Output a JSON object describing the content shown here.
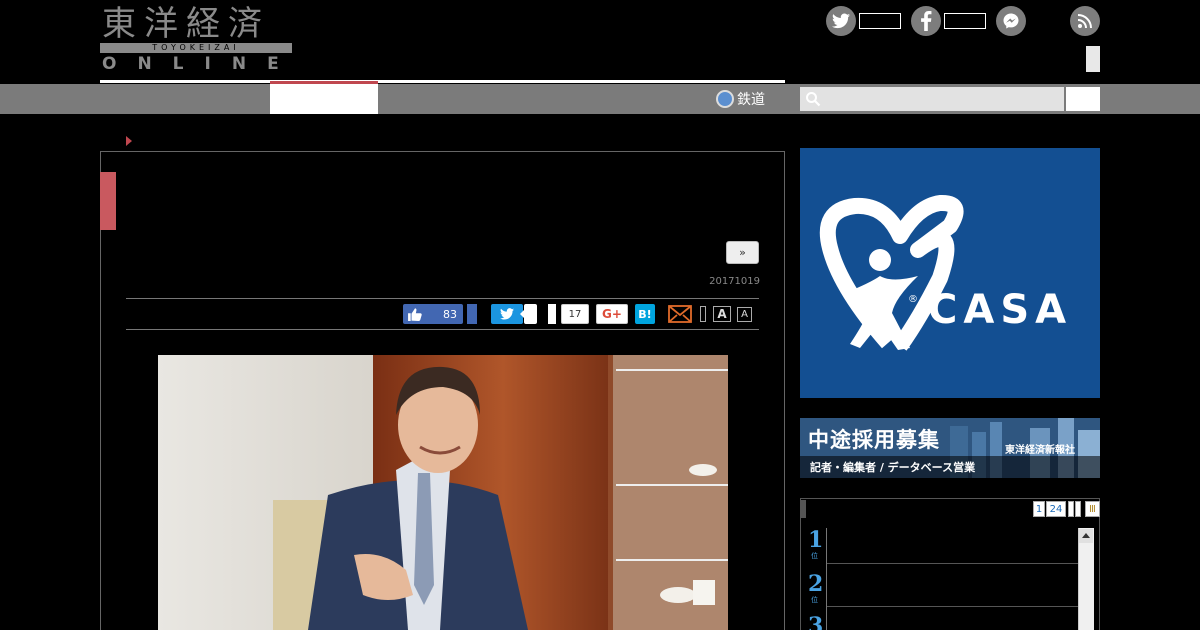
{
  "logo": {
    "kanji": "東洋経済",
    "romaji": "TOYOKEIZAI",
    "online": "ONLINE"
  },
  "header": {
    "social_icons": [
      "twitter-icon",
      "facebook-icon",
      "messenger-icon",
      "rss-icon"
    ]
  },
  "nav": {
    "rail_label": "鉄道"
  },
  "search": {
    "placeholder": ""
  },
  "article": {
    "next_label": "»",
    "date": "20171019",
    "share": {
      "fb_count": "83",
      "gplus_count": "17",
      "gplus_label": "G+",
      "hatena_label": "B!",
      "font_large": "A",
      "font_small": "A"
    }
  },
  "sidebar": {
    "casa_ad": {
      "brand": "CASA",
      "registered": "®"
    },
    "recruit_ad": {
      "title": "中途採用募集",
      "company": "東洋経済新報社",
      "subtitle": "記者・編集者 / データベース営業"
    },
    "ranking": {
      "tabs": [
        "1",
        "24"
      ],
      "last_tab": "Ⅲ",
      "items": [
        {
          "num": "1",
          "sub": "位"
        },
        {
          "num": "2",
          "sub": "位"
        },
        {
          "num": "3",
          "sub": ""
        }
      ]
    }
  },
  "colors": {
    "accent_red": "#c9595f",
    "nav_gray": "#7b7b7b",
    "casa_blue": "#134f92",
    "facebook": "#4267b2",
    "twitter": "#1b95e0",
    "hatena": "#00a4de"
  }
}
